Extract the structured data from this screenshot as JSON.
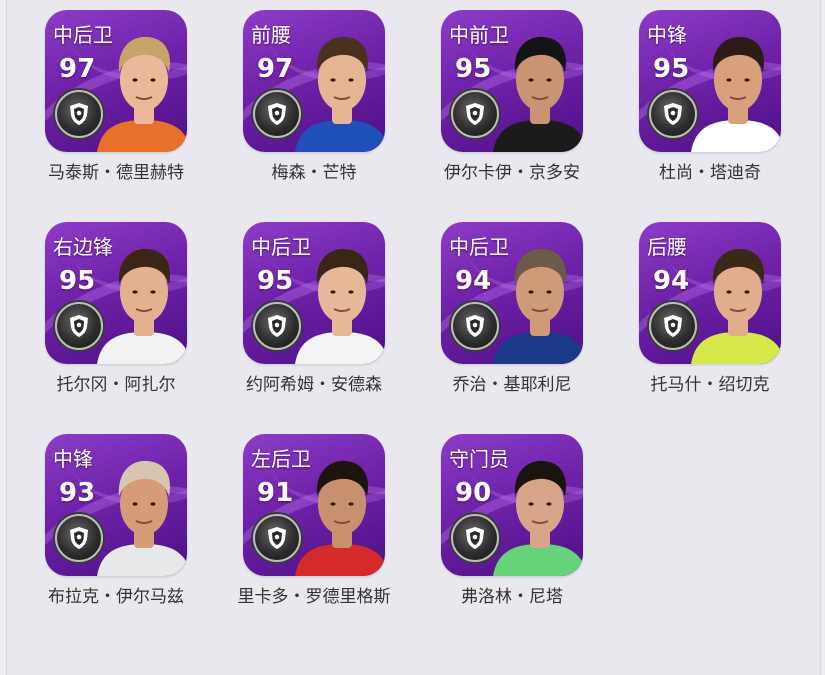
{
  "players": [
    {
      "position": "中后卫",
      "rating": "97",
      "name": "马泰斯・德里赫特",
      "kit_color": "#e8702a",
      "skin_color": "#e9b99a",
      "hair_color": "#c9a46a",
      "badge_icon": "shield-icon"
    },
    {
      "position": "前腰",
      "rating": "97",
      "name": "梅森・芒特",
      "kit_color": "#1f4fb8",
      "skin_color": "#e6b593",
      "hair_color": "#4a3020",
      "badge_icon": "shield-icon"
    },
    {
      "position": "中前卫",
      "rating": "95",
      "name": "伊尔卡伊・京多安",
      "kit_color": "#1b1b1b",
      "skin_color": "#c99474",
      "hair_color": "#141414",
      "badge_icon": "shield-icon"
    },
    {
      "position": "中锋",
      "rating": "95",
      "name": "杜尚・塔迪奇",
      "kit_color": "#ffffff",
      "skin_color": "#d9a07c",
      "hair_color": "#2b1d14",
      "badge_icon": "shield-icon"
    },
    {
      "position": "右边锋",
      "rating": "95",
      "name": "托尔冈・阿扎尔",
      "kit_color": "#f2f2f2",
      "skin_color": "#e4b190",
      "hair_color": "#3b2516",
      "badge_icon": "shield-icon"
    },
    {
      "position": "中后卫",
      "rating": "95",
      "name": "约阿希姆・安德森",
      "kit_color": "#f4f4f4",
      "skin_color": "#e7b898",
      "hair_color": "#3a2616",
      "badge_icon": "shield-icon"
    },
    {
      "position": "中后卫",
      "rating": "94",
      "name": "乔治・基耶利尼",
      "kit_color": "#1c3a8a",
      "skin_color": "#cf9a78",
      "hair_color": "#6b5a48",
      "badge_icon": "shield-icon"
    },
    {
      "position": "后腰",
      "rating": "94",
      "name": "托马什・绍切克",
      "kit_color": "#d7e84a",
      "skin_color": "#e2ad8c",
      "hair_color": "#3c2818",
      "badge_icon": "shield-icon"
    },
    {
      "position": "中锋",
      "rating": "93",
      "name": "布拉克・伊尔马兹",
      "kit_color": "#e8e8e8",
      "skin_color": "#d69b78",
      "hair_color": "#d6c5b0",
      "badge_icon": "shield-icon"
    },
    {
      "position": "左后卫",
      "rating": "91",
      "name": "里卡多・罗德里格斯",
      "kit_color": "#d42a2a",
      "skin_color": "#c99070",
      "hair_color": "#1d1410",
      "badge_icon": "shield-icon"
    },
    {
      "position": "守门员",
      "rating": "90",
      "name": "弗洛林・尼塔",
      "kit_color": "#66d27a",
      "skin_color": "#d9a588",
      "hair_color": "#1a1410",
      "badge_icon": "shield-icon"
    }
  ]
}
